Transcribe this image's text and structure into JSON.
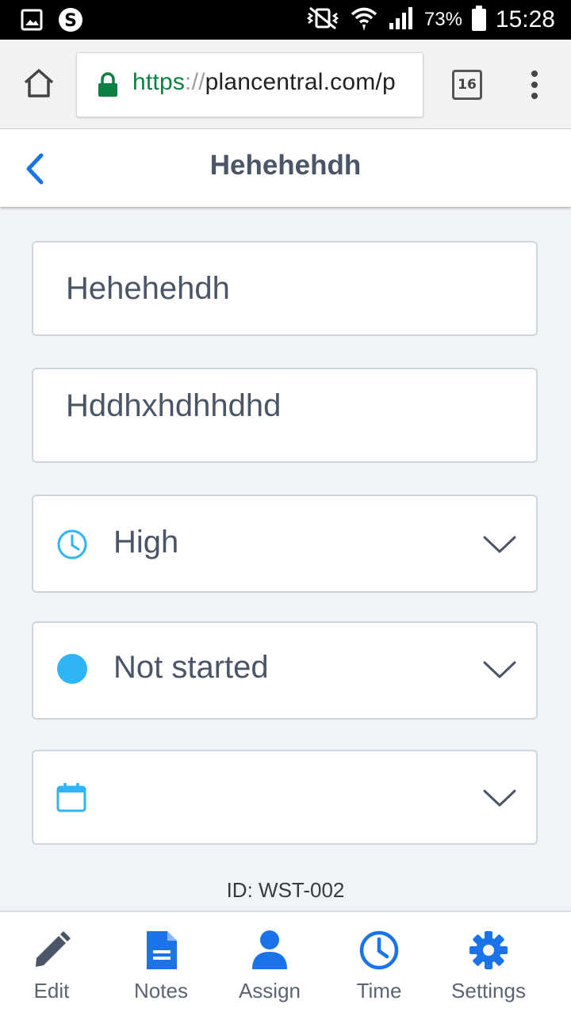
{
  "status_bar": {
    "battery": "73%",
    "time": "15:28"
  },
  "browser": {
    "url_scheme": "https",
    "url_separator": "://",
    "url_host": "plancentral.com/p",
    "tab_count": "16"
  },
  "header": {
    "title": "Hehehehdh"
  },
  "form": {
    "title_value": "Hehehehdh",
    "description_value": "Hddhxhdhhdhd",
    "priority_value": "High",
    "status_value": "Not started",
    "due_date_value": "",
    "id_label": "ID: WST-002"
  },
  "bottom_nav": {
    "edit": "Edit",
    "notes": "Notes",
    "assign": "Assign",
    "time": "Time",
    "settings": "Settings"
  },
  "colors": {
    "accent_blue": "#1a73e8",
    "light_blue": "#2eb5f5",
    "text": "#4a5568",
    "icon_gray": "#4a5568"
  }
}
